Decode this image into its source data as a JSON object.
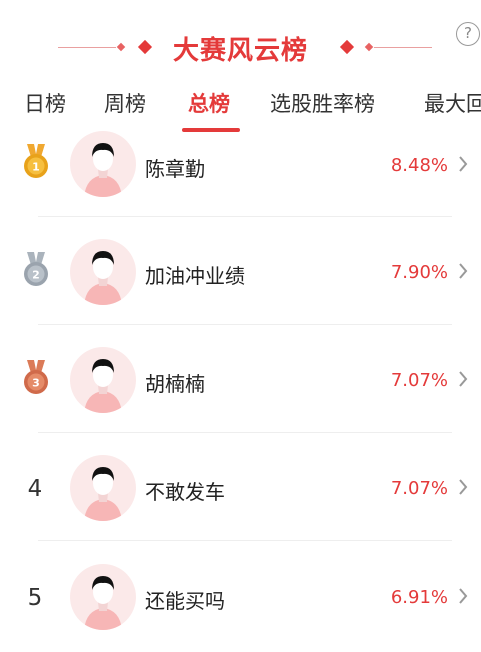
{
  "header": {
    "title": "大赛风云榜",
    "help_glyph": "?"
  },
  "tabs": [
    {
      "label": "日榜",
      "active": false
    },
    {
      "label": "周榜",
      "active": false
    },
    {
      "label": "总榜",
      "active": true
    },
    {
      "label": "选股胜率榜",
      "active": false
    },
    {
      "label": "最大回",
      "active": false
    }
  ],
  "colors": {
    "accent": "#e43a3a",
    "gold": "#e8a21a",
    "silver": "#9aa3ad",
    "bronze": "#d06a4a"
  },
  "ranking": [
    {
      "rank": "1",
      "badge": "gold-medal-icon",
      "name": "陈章勤",
      "value": "8.48%"
    },
    {
      "rank": "2",
      "badge": "silver-medal-icon",
      "name": "加油冲业绩",
      "value": "7.90%"
    },
    {
      "rank": "3",
      "badge": "bronze-medal-icon",
      "name": "胡楠楠",
      "value": "7.07%"
    },
    {
      "rank": "4",
      "badge": null,
      "name": "不敢发车",
      "value": "7.07%"
    },
    {
      "rank": "5",
      "badge": null,
      "name": "还能买吗",
      "value": "6.91%"
    }
  ]
}
